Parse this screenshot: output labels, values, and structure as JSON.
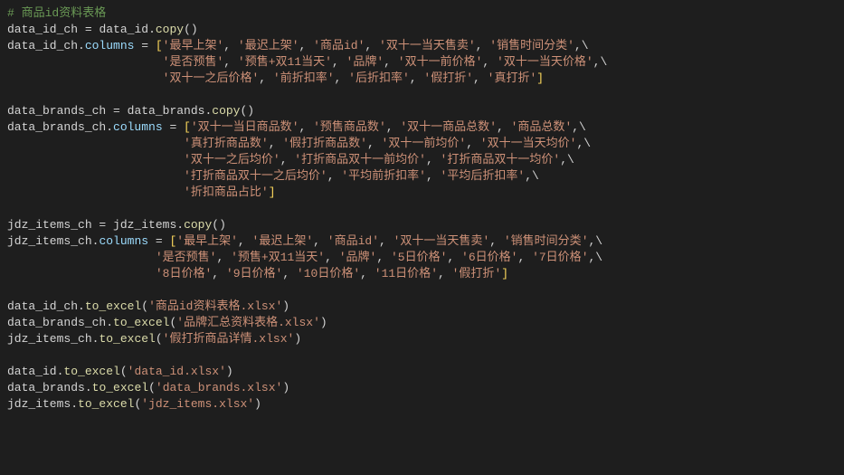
{
  "comment": "# 商品id资料表格",
  "block1": {
    "assign_line_prefix": "data_id_ch ",
    "assign_op": "=",
    "assign_rhs_obj": " data_id",
    "copy_call": "copy",
    "col_target": "data_id_ch",
    "col_attr": "columns",
    "cols": [
      "最早上架",
      "最迟上架",
      "商品id",
      "双十一当天售卖",
      "销售时间分类",
      "是否预售",
      "预售+双11当天",
      "品牌",
      "双十一前价格",
      "双十一当天价格",
      "双十一之后价格",
      "前折扣率",
      "后折扣率",
      "假打折",
      "真打折"
    ]
  },
  "block2": {
    "assign_line_prefix": "data_brands_ch ",
    "assign_op": "=",
    "assign_rhs_obj": " data_brands",
    "copy_call": "copy",
    "col_target": "data_brands_ch",
    "col_attr": "columns",
    "cols": [
      "双十一当日商品数",
      "预售商品数",
      "双十一商品总数",
      "商品总数",
      "真打折商品数",
      "假打折商品数",
      "双十一前均价",
      "双十一当天均价",
      "双十一之后均价",
      "打折商品双十一前均价",
      "打折商品双十一均价",
      "打折商品双十一之后均价",
      "平均前折扣率",
      "平均后折扣率",
      "折扣商品占比"
    ]
  },
  "block3": {
    "assign_line_prefix": "jdz_items_ch ",
    "assign_op": "=",
    "assign_rhs_obj": " jdz_items",
    "copy_call": "copy",
    "col_target": "jdz_items_ch",
    "col_attr": "columns",
    "cols": [
      "最早上架",
      "最迟上架",
      "商品id",
      "双十一当天售卖",
      "销售时间分类",
      "是否预售",
      "预售+双11当天",
      "品牌",
      "5日价格",
      "6日价格",
      "7日价格",
      "8日价格",
      "9日价格",
      "10日价格",
      "11日价格",
      "假打折"
    ]
  },
  "excel1": [
    {
      "obj": "data_id_ch",
      "fn": "to_excel",
      "arg": "商品id资料表格.xlsx"
    },
    {
      "obj": "data_brands_ch",
      "fn": "to_excel",
      "arg": "品牌汇总资料表格.xlsx"
    },
    {
      "obj": "jdz_items_ch",
      "fn": "to_excel",
      "arg": "假打折商品详情.xlsx"
    }
  ],
  "excel2": [
    {
      "obj": "data_id",
      "fn": "to_excel",
      "arg": "data_id.xlsx"
    },
    {
      "obj": "data_brands",
      "fn": "to_excel",
      "arg": "data_brands.xlsx"
    },
    {
      "obj": "jdz_items",
      "fn": "to_excel",
      "arg": "jdz_items.xlsx"
    }
  ]
}
